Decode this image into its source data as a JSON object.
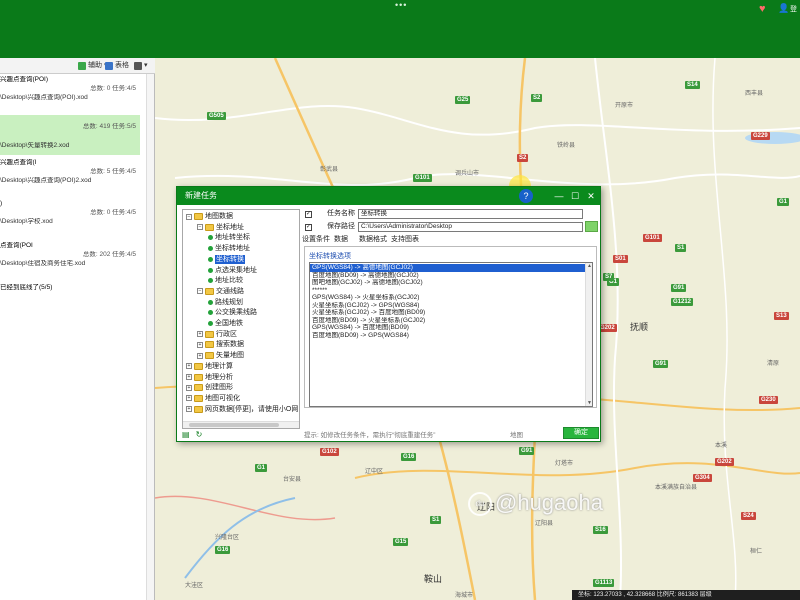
{
  "topbar": {
    "dots": "•••",
    "right_label": "登"
  },
  "toolbar": {
    "assist_label": "辅助",
    "table_label": "表格"
  },
  "tasks": [
    {
      "title": "兴趣点查询(POI)",
      "stat": "总数: 0  任务:4/5"
    },
    {
      "title": "\\Desktop\\兴趣点查询(POI).xod",
      "stat": ""
    },
    {
      "title": "",
      "stat": "总数: 419  任务:5/5"
    },
    {
      "title": "\\Desktop\\矢量转换2.xod",
      "stat": ""
    },
    {
      "title": "兴趣点查询(I",
      "stat": "总数: 5  任务:4/5"
    },
    {
      "title": "\\Desktop\\兴趣点查询(POI)2.xod",
      "stat": ""
    },
    {
      "title": ")",
      "stat": "总数: 0  任务:4/5"
    },
    {
      "title": "\\Desktop\\学校.xod",
      "stat": ""
    },
    {
      "title": "点查询(POI",
      "stat": "总数: 202  任务:4/5"
    },
    {
      "title": "\\Desktop\\住宿及商务住宅.xod",
      "stat": ""
    },
    {
      "title": "已经到底线了(5/5)",
      "stat": ""
    }
  ],
  "map": {
    "road_labels": [
      {
        "text": "G505",
        "kind": "g"
      },
      {
        "text": "G25",
        "kind": "g"
      },
      {
        "text": "S2",
        "kind": "g"
      },
      {
        "text": "S14",
        "kind": "g"
      },
      {
        "text": "S2",
        "kind": "r"
      },
      {
        "text": "G101",
        "kind": "g"
      },
      {
        "text": "G229",
        "kind": "r"
      },
      {
        "text": "G1",
        "kind": "g"
      },
      {
        "text": "G101",
        "kind": "r"
      },
      {
        "text": "S1",
        "kind": "g"
      },
      {
        "text": "S01",
        "kind": "r"
      },
      {
        "text": "G1",
        "kind": "g"
      },
      {
        "text": "G91",
        "kind": "g"
      },
      {
        "text": "S7",
        "kind": "g"
      },
      {
        "text": "G1212",
        "kind": "g"
      },
      {
        "text": "S13",
        "kind": "r"
      },
      {
        "text": "G202",
        "kind": "r"
      },
      {
        "text": "G91",
        "kind": "g"
      },
      {
        "text": "G230",
        "kind": "r"
      },
      {
        "text": "G1",
        "kind": "g"
      },
      {
        "text": "G102",
        "kind": "r"
      },
      {
        "text": "G16",
        "kind": "g"
      },
      {
        "text": "G91",
        "kind": "g"
      },
      {
        "text": "G304",
        "kind": "r"
      },
      {
        "text": "G15",
        "kind": "g"
      },
      {
        "text": "S1",
        "kind": "g"
      },
      {
        "text": "G16",
        "kind": "g"
      },
      {
        "text": "G1113",
        "kind": "g"
      },
      {
        "text": "S16",
        "kind": "g"
      },
      {
        "text": "G202",
        "kind": "r"
      },
      {
        "text": "S24",
        "kind": "r"
      }
    ],
    "cities": [
      "抚顺",
      "辽阳",
      "鞍山"
    ],
    "towns": [
      "铁岭县",
      "调兵山市",
      "彰武县",
      "阜新",
      "开原市",
      "西丰县",
      "清原",
      "本溪",
      "本溪满族自治县",
      "台安县",
      "兴隆台区",
      "辽中区",
      "大洼区",
      "海城市",
      "灯塔市",
      "桓仁",
      "辽阳县"
    ]
  },
  "watermark": {
    "brand": "du",
    "text": "@hugaoha"
  },
  "statusbar": {
    "text": "坐标: 123.27033 , 42.328668    比例尺: 861383   层级"
  },
  "dialog": {
    "title": "新建任务",
    "controls": {
      "min": "—",
      "max": "☐",
      "close": "✕"
    },
    "tree": [
      {
        "label": "地图数据",
        "level": 0,
        "kind": "folder",
        "exp": "−"
      },
      {
        "label": "坐标地址",
        "level": 1,
        "kind": "folder",
        "exp": "−"
      },
      {
        "label": "地址转坐标",
        "level": 2,
        "kind": "leaf"
      },
      {
        "label": "坐标转地址",
        "level": 2,
        "kind": "leaf"
      },
      {
        "label": "坐标转换",
        "level": 2,
        "kind": "leaf",
        "selected": true
      },
      {
        "label": "点选采集地址",
        "level": 2,
        "kind": "leaf"
      },
      {
        "label": "地址比较",
        "level": 2,
        "kind": "leaf"
      },
      {
        "label": "交通线路",
        "level": 1,
        "kind": "folder",
        "exp": "−"
      },
      {
        "label": "路线规划",
        "level": 2,
        "kind": "leaf"
      },
      {
        "label": "公交换乘线路",
        "level": 2,
        "kind": "leaf"
      },
      {
        "label": "全国地铁",
        "level": 2,
        "kind": "leaf"
      },
      {
        "label": "行政区",
        "level": 1,
        "kind": "folder",
        "exp": "+"
      },
      {
        "label": "搜索数据",
        "level": 1,
        "kind": "folder",
        "exp": "+"
      },
      {
        "label": "矢量地图",
        "level": 1,
        "kind": "folder",
        "exp": "+"
      },
      {
        "label": "地理计算",
        "level": 0,
        "kind": "folder",
        "exp": "+"
      },
      {
        "label": "地理分析",
        "level": 0,
        "kind": "folder",
        "exp": "+"
      },
      {
        "label": "创建图形",
        "level": 0,
        "kind": "folder",
        "exp": "+"
      },
      {
        "label": "地图可视化",
        "level": 0,
        "kind": "folder",
        "exp": "+"
      },
      {
        "label": "网页数据[停更]，请使用小O网",
        "level": 0,
        "kind": "folder",
        "exp": "+"
      }
    ],
    "task_name_label": "任务名称",
    "task_name_value": "坐标转换",
    "save_path_label": "保存路径",
    "save_path_value": "C:\\Users\\Administrator\\Desktop",
    "tabs": [
      "设置条件",
      "数据",
      "数据格式",
      "支持图表"
    ],
    "options_header": "坐标转换选项",
    "options": [
      "GPS(WGS84) -> 高德地图(GCJ02)",
      "百度地图(BD09) -> 高德地图(GCJ02)",
      "图吧地图(GCJ02) -> 高德地图(GCJ02)",
      "******",
      "GPS(WGS84) -> 火星坐标系(GCJ02)",
      "火星坐标系(GCJ02) -> GPS(WGS84)",
      "火星坐标系(GCJ02) -> 百度地图(BD09)",
      "百度地图(BD09) -> 火星坐标系(GCJ02)",
      "GPS(WGS84) -> 百度地图(BD09)",
      "百度地图(BD09) -> GPS(WGS84)"
    ],
    "hint": "提示: 如修改任务条件，需执行“彻底重建任务”",
    "map_label": "地图",
    "ok_label": "确定"
  }
}
